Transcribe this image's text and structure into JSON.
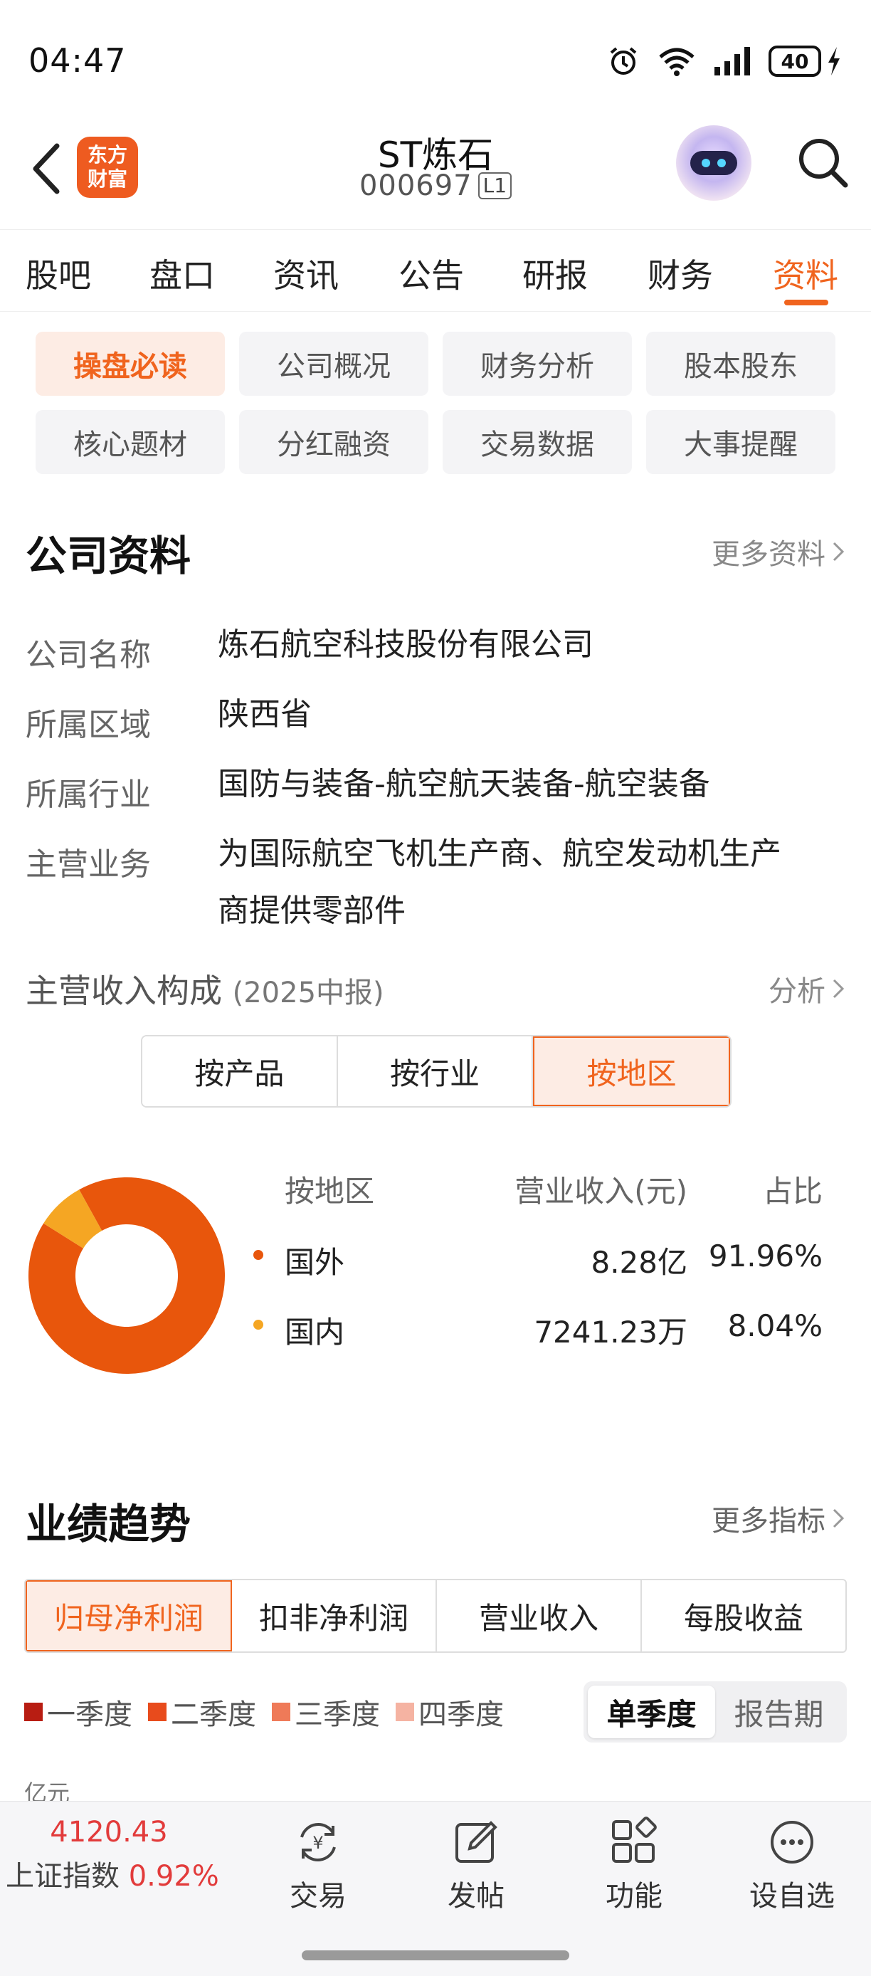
{
  "status_bar": {
    "time": "04:47",
    "battery": "40"
  },
  "header": {
    "logo_line1": "东方",
    "logo_line2": "财富",
    "stock_name": "ST炼石",
    "stock_code": "000697",
    "level_badge": "L1"
  },
  "main_tabs": [
    "股吧",
    "盘口",
    "资讯",
    "公告",
    "研报",
    "财务",
    "资料"
  ],
  "main_tab_active": "资料",
  "sub_nav": [
    "操盘必读",
    "公司概况",
    "财务分析",
    "股本股东",
    "核心题材",
    "分红融资",
    "交易数据",
    "大事提醒"
  ],
  "sub_nav_active": "操盘必读",
  "company_section": {
    "title": "公司资料",
    "more": "更多资料",
    "rows": [
      {
        "label": "公司名称",
        "value": "炼石航空科技股份有限公司"
      },
      {
        "label": "所属区域",
        "value": "陕西省"
      },
      {
        "label": "所属行业",
        "value": "国防与装备-航空航天装备-航空装备"
      },
      {
        "label": "主营业务",
        "value_line1": "为国际航空飞机生产商、航空发动机生产",
        "value_line2": "商提供零部件"
      }
    ]
  },
  "revenue": {
    "title": "主营收入构成",
    "period": "(2025中报)",
    "analysis": "分析",
    "segments": [
      "按产品",
      "按行业",
      "按地区"
    ],
    "segment_active": "按地区",
    "table_headers": [
      "按地区",
      "营业收入(元)",
      "占比"
    ],
    "rows": [
      {
        "name": "国外",
        "revenue": "8.28亿",
        "ratio": "91.96%",
        "pct": 91.96,
        "color": "#e8560c"
      },
      {
        "name": "国内",
        "revenue": "7241.23万",
        "ratio": "8.04%",
        "pct": 8.04,
        "color": "#f5a623"
      }
    ]
  },
  "performance": {
    "title": "业绩趋势",
    "more": "更多指标",
    "tabs": [
      "归母净利润",
      "扣非净利润",
      "营业收入",
      "每股收益"
    ],
    "tab_active": "归母净利润",
    "legend": [
      {
        "label": "一季度",
        "color": "#b81d12"
      },
      {
        "label": "二季度",
        "color": "#e84b1c"
      },
      {
        "label": "三季度",
        "color": "#ef7a58"
      },
      {
        "label": "四季度",
        "color": "#f5b3a2"
      }
    ],
    "period_toggle": [
      "单季度",
      "报告期"
    ],
    "period_active": "单季度",
    "unit": "亿元"
  },
  "bottom_bar": {
    "index_price": "4120.43",
    "index_name": "上证指数",
    "index_pct": "0.92%",
    "items": [
      "交易",
      "发帖",
      "功能",
      "设自选"
    ]
  }
}
